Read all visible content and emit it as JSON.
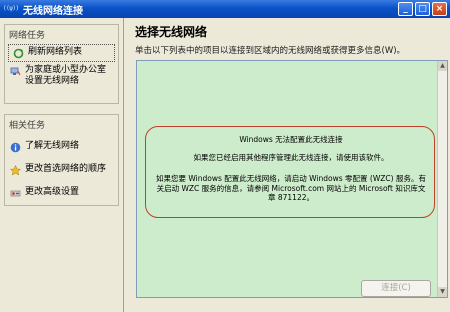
{
  "window": {
    "title": "无线网络连接",
    "icon_text": "((ψ))",
    "buttons": {
      "minimize": "_",
      "maximize": "□",
      "close": "×"
    }
  },
  "sidebar": {
    "network_tasks": {
      "title": "网络任务",
      "items": [
        {
          "label": "刷新网络列表",
          "icon": "refresh-icon",
          "selected": true
        },
        {
          "label": "为家庭或小型办公室设置无线网络",
          "icon": "home-network-icon"
        }
      ]
    },
    "related_tasks": {
      "title": "相关任务",
      "items": [
        {
          "label": "了解无线网络",
          "icon": "info-icon"
        },
        {
          "label": "更改首选网络的顺序",
          "icon": "star-icon"
        },
        {
          "label": "更改高级设置",
          "icon": "settings-icon"
        }
      ]
    }
  },
  "main": {
    "heading": "选择无线网络",
    "description": "单击以下列表中的项目以连接到区域内的无线网络或获得更多信息(W)。",
    "message": {
      "line1": "Windows 无法配置此无线连接",
      "line2": "如果您已经启用其他程序管理此无线连接，请使用该软件。",
      "line3": "如果您要 Windows 配置此无线网络，请启动 Windows 零配置 (WZC) 服务。有关启动 WZC 服务的信息，请参阅 Microsoft.com 网站上的 Microsoft 知识库文章 871122。"
    },
    "connect_button": "连接(C)"
  },
  "colors": {
    "titlebar": "#0a52c8",
    "list_background": "#cdeccb",
    "message_border": "#c0402c"
  }
}
